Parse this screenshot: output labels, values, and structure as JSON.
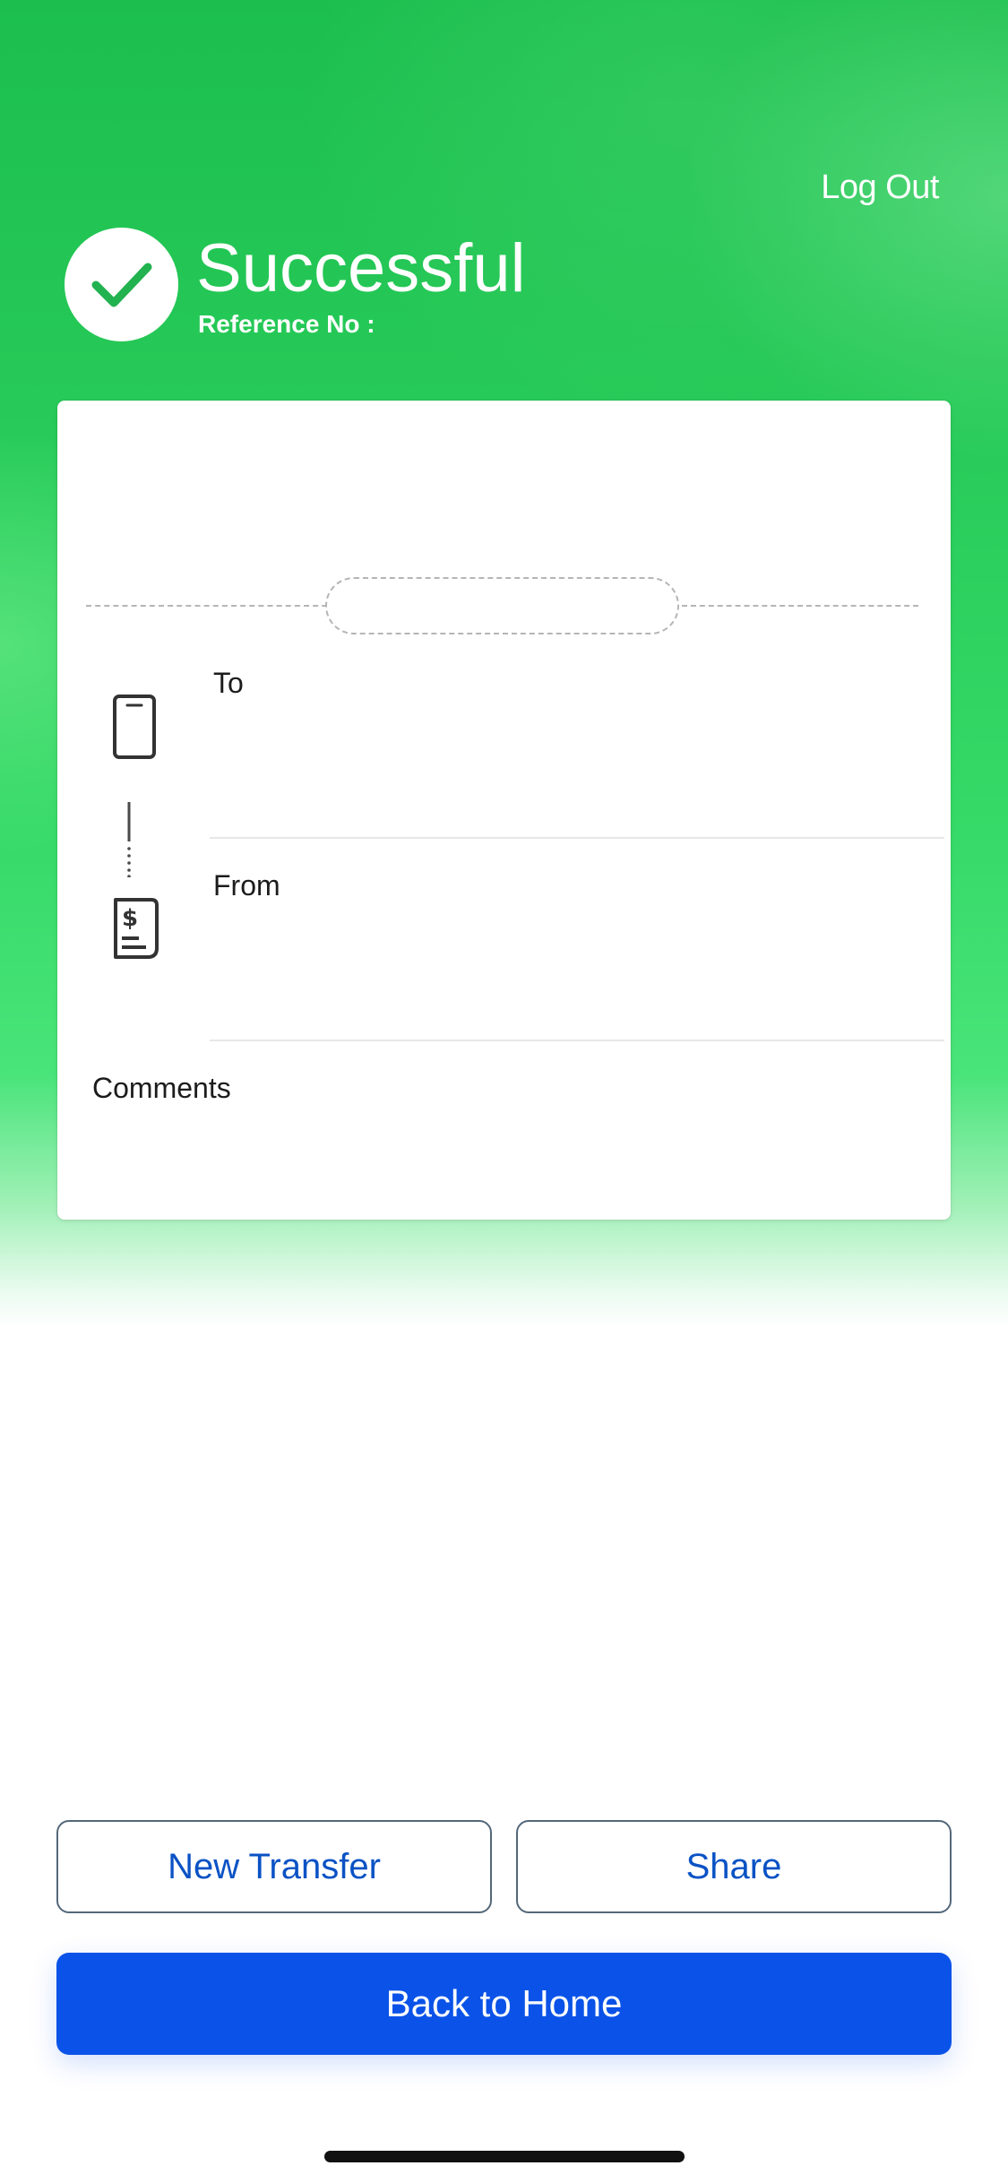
{
  "header": {
    "logout_label": "Log Out",
    "status_title": "Successful",
    "reference_label": "Reference No :"
  },
  "receipt": {
    "to_label": "To",
    "from_label": "From",
    "comments_label": "Comments"
  },
  "actions": {
    "new_transfer_label": "New Transfer",
    "share_label": "Share",
    "back_home_label": "Back to Home"
  },
  "icons": {
    "status": "check-icon",
    "to": "phone-icon",
    "from": "bill-icon",
    "connector": "dotted-connector"
  },
  "colors": {
    "accent_green": "#22c55a",
    "primary_blue": "#0b53e8",
    "outline_text_blue": "#0a52c5"
  }
}
